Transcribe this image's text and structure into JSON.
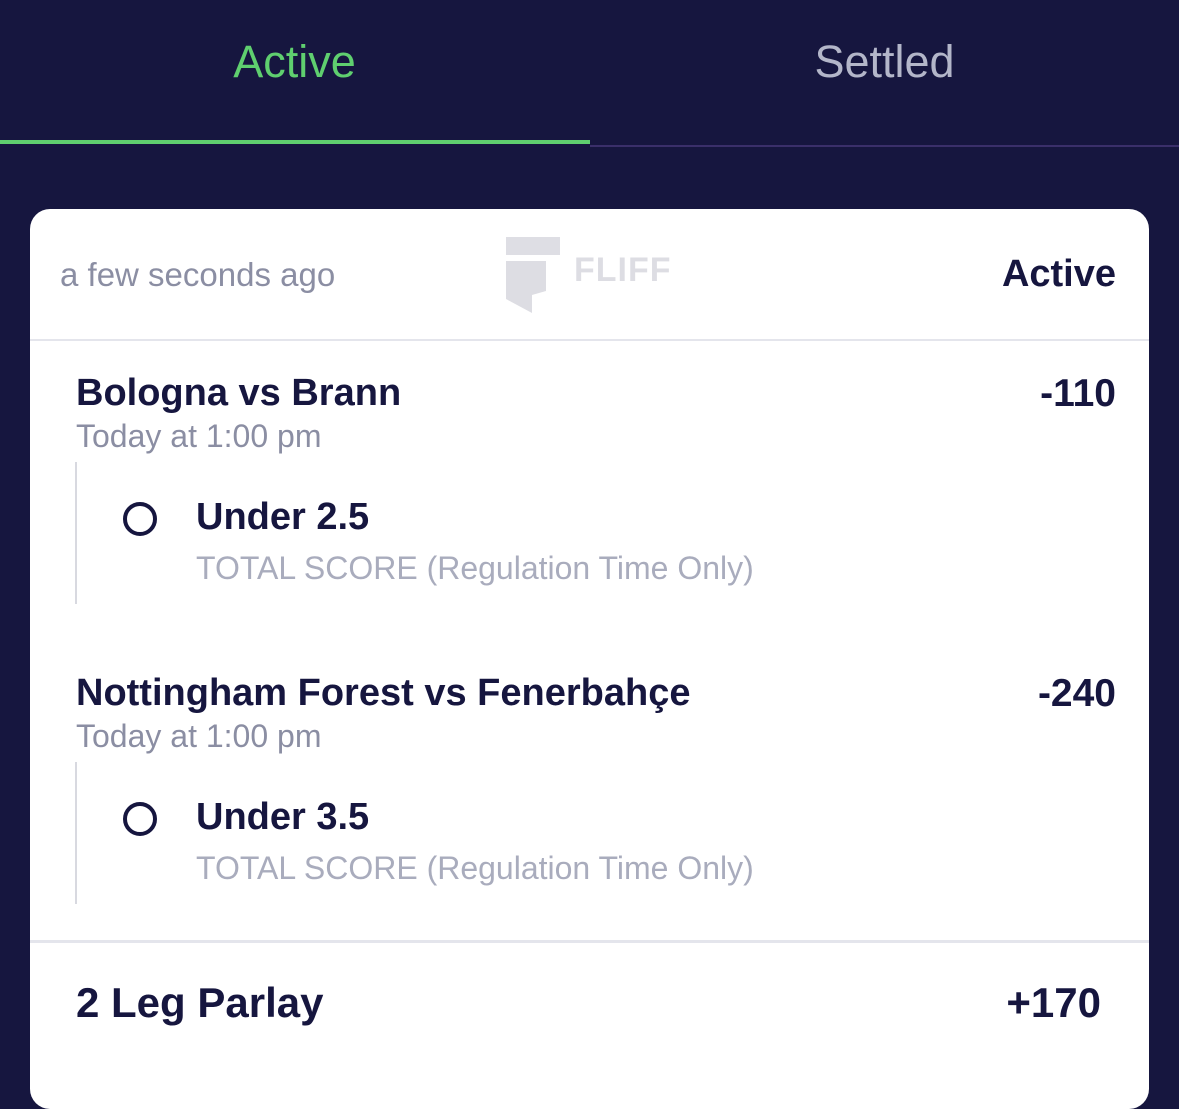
{
  "tabs": {
    "active_label": "Active",
    "settled_label": "Settled"
  },
  "card": {
    "timestamp": "a few seconds ago",
    "watermark": "FLIFF",
    "status": "Active",
    "legs": [
      {
        "title": "Bologna vs Brann",
        "odds": "-110",
        "time": "Today at 1:00 pm",
        "pick": "Under 2.5",
        "market": "TOTAL SCORE (Regulation Time Only)"
      },
      {
        "title": "Nottingham Forest vs Fenerbahçe",
        "odds": "-240",
        "time": "Today at 1:00 pm",
        "pick": "Under 3.5",
        "market": "TOTAL SCORE (Regulation Time Only)"
      }
    ],
    "parlay": {
      "title": "2 Leg Parlay",
      "odds": "+170"
    }
  },
  "colors": {
    "background": "#16163f",
    "active_tab": "#5fcf6f",
    "inactive_tab": "#b3b6c9",
    "text_primary": "#16163f",
    "text_secondary": "#8b8ea3"
  }
}
